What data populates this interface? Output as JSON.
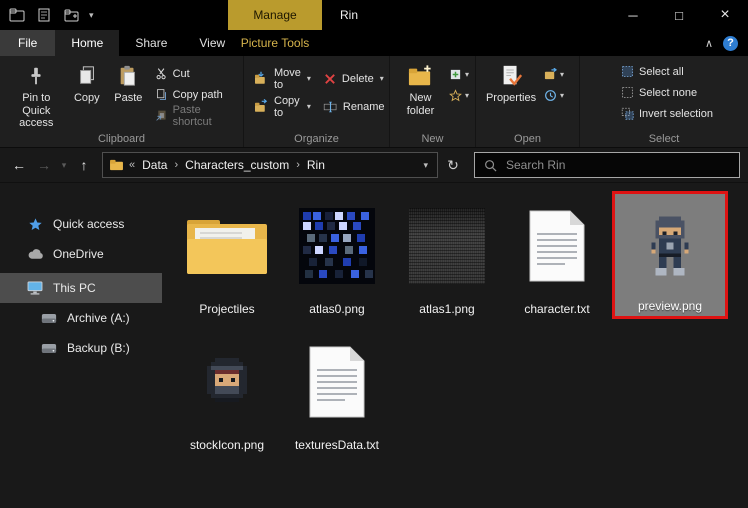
{
  "titlebar": {
    "manage_label": "Manage",
    "title": "Rin"
  },
  "tabs": {
    "file": "File",
    "home": "Home",
    "share": "Share",
    "view": "View",
    "contextual": "Picture Tools"
  },
  "ribbon": {
    "groups": {
      "clipboard": "Clipboard",
      "organize": "Organize",
      "new": "New",
      "open": "Open",
      "select": "Select"
    },
    "pin": "Pin to Quick access",
    "copy": "Copy",
    "paste": "Paste",
    "cut": "Cut",
    "copy_path": "Copy path",
    "paste_shortcut": "Paste shortcut",
    "move_to": "Move to",
    "copy_to": "Copy to",
    "delete": "Delete",
    "rename": "Rename",
    "new_folder": "New folder",
    "properties": "Properties",
    "select_all": "Select all",
    "select_none": "Select none",
    "invert_selection": "Invert selection"
  },
  "nav": {
    "laquo": "«",
    "crumbs": [
      "Data",
      "Characters_custom",
      "Rin"
    ],
    "search_placeholder": "Search Rin"
  },
  "sidebar": {
    "items": [
      {
        "label": "Quick access"
      },
      {
        "label": "OneDrive"
      },
      {
        "label": "This PC",
        "selected": true
      },
      {
        "label": "Archive (A:)"
      },
      {
        "label": "Backup (B:)"
      }
    ]
  },
  "files": [
    {
      "label": "Projectiles",
      "type": "folder"
    },
    {
      "label": "atlas0.png",
      "type": "image"
    },
    {
      "label": "atlas1.png",
      "type": "image"
    },
    {
      "label": "character.txt",
      "type": "text"
    },
    {
      "label": "preview.png",
      "type": "image",
      "selected": true
    },
    {
      "label": "stockIcon.png",
      "type": "image"
    },
    {
      "label": "texturesData.txt",
      "type": "text"
    }
  ],
  "glyphs": {
    "minimize": "─",
    "maximize": "□",
    "close": "×",
    "back": "←",
    "forward": "→",
    "up": "↑",
    "refresh": "↻",
    "dropdown": "▾",
    "crumb_sep": "›",
    "collapse": "∧",
    "help": "?"
  },
  "colors": {
    "manage_tab_gold": "#BA9B2D",
    "contextual_text": "#D6B44C",
    "selection_border_red": "#DE1212",
    "folder_yellow": "#E8B64A",
    "sidebar_selected_bg": "#4D4D4D",
    "help_blue": "#2E7DD1"
  }
}
